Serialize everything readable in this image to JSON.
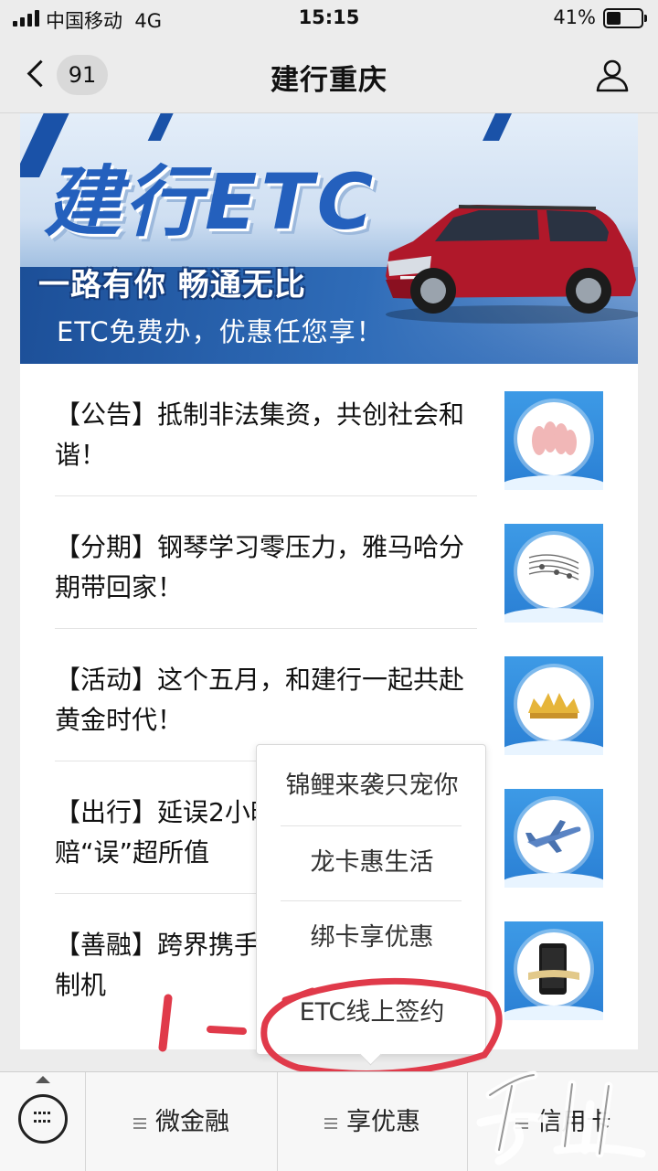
{
  "status_bar": {
    "carrier": "中国移动",
    "network": "4G",
    "time": "15:15",
    "battery_percent_label": "41%",
    "battery_level": 0.41
  },
  "nav": {
    "back_icon": "chevron-left-icon",
    "unread_count": "91",
    "title": "建行重庆",
    "profile_icon": "person-icon"
  },
  "banner": {
    "title": "建行ETC",
    "slogan": "一路有你  畅通无比",
    "subtitle": "ETC免费办，优惠任您享！",
    "image": "red-suv-car"
  },
  "articles": [
    {
      "text": "【公告】抵制非法集资，共创社会和谐！",
      "thumb_icon": "hands-icon"
    },
    {
      "text": "【分期】钢琴学习零压力，雅马哈分期带回家！",
      "thumb_icon": "music-notes-icon"
    },
    {
      "text": "【活动】这个五月，和建行一起共赴黄金时代！",
      "thumb_icon": "gold-crown-icon"
    },
    {
      "text": "【出行】延误2小时赔付 保险理赔“误”超所值",
      "thumb_icon": "airplane-icon"
    },
    {
      "text": "【善融】跨界携手 华为P30建行定制机",
      "thumb_icon": "phone-icon"
    }
  ],
  "popup_menu": {
    "items": [
      "锦鲤来袭只宠你",
      "龙卡惠生活",
      "绑卡享优惠",
      "ETC线上签约"
    ]
  },
  "annotation": {
    "color": "#e03a4a"
  },
  "bottom_menu": {
    "keyboard_icon": "keyboard-icon",
    "tabs": [
      "微金融",
      "享优惠",
      "信用卡"
    ]
  },
  "colors": {
    "brand_blue": "#2460bd",
    "thumb_blue": "#2a7fd4"
  }
}
